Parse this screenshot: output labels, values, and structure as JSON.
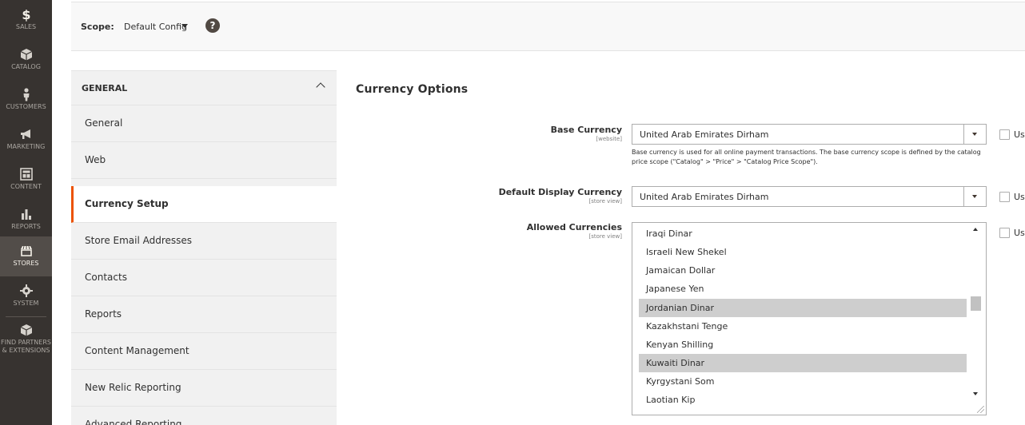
{
  "admin_nav": {
    "items": [
      {
        "label": "SALES",
        "icon": "dollar-icon"
      },
      {
        "label": "CATALOG",
        "icon": "box-icon"
      },
      {
        "label": "CUSTOMERS",
        "icon": "person-icon"
      },
      {
        "label": "MARKETING",
        "icon": "megaphone-icon"
      },
      {
        "label": "CONTENT",
        "icon": "layout-icon"
      },
      {
        "label": "REPORTS",
        "icon": "bar-chart-icon"
      },
      {
        "label": "STORES",
        "icon": "store-icon"
      },
      {
        "label": "SYSTEM",
        "icon": "gear-icon"
      },
      {
        "label_line1": "FIND PARTNERS",
        "label_line2": "& EXTENSIONS",
        "icon": "partners-icon"
      }
    ],
    "active": "STORES"
  },
  "scope": {
    "label": "Scope:",
    "value": "Default Config",
    "help": "?"
  },
  "config_nav": {
    "section_title": "GENERAL",
    "items": [
      "General",
      "Web",
      "Currency Setup",
      "Store Email Addresses",
      "Contacts",
      "Reports",
      "Content Management",
      "New Relic Reporting",
      "Advanced Reporting"
    ],
    "active": "Currency Setup"
  },
  "form": {
    "heading": "Currency Options",
    "base_currency": {
      "label": "Base Currency",
      "scope": "[website]",
      "value": "United Arab Emirates Dirham",
      "note": "Base currency is used for all online payment transactions. The base currency scope is defined by the catalog price scope (\"Catalog\" > \"Price\" > \"Catalog Price Scope\")."
    },
    "display_currency": {
      "label": "Default Display Currency",
      "scope": "[store view]",
      "value": "United Arab Emirates Dirham"
    },
    "allowed_currencies": {
      "label": "Allowed Currencies",
      "scope": "[store view]",
      "options": [
        {
          "label": "Iraqi Dinar",
          "selected": false
        },
        {
          "label": "Israeli New Shekel",
          "selected": false
        },
        {
          "label": "Jamaican Dollar",
          "selected": false
        },
        {
          "label": "Japanese Yen",
          "selected": false
        },
        {
          "label": "Jordanian Dinar",
          "selected": true
        },
        {
          "label": "Kazakhstani Tenge",
          "selected": false
        },
        {
          "label": "Kenyan Shilling",
          "selected": false
        },
        {
          "label": "Kuwaiti Dinar",
          "selected": true
        },
        {
          "label": "Kyrgystani Som",
          "selected": false
        },
        {
          "label": "Laotian Kip",
          "selected": false
        }
      ]
    },
    "use_default_label": "Use"
  },
  "colors": {
    "nav_bg": "#373330",
    "nav_active": "#524d49",
    "accent": "#eb5202",
    "selected_option": "#cecece"
  }
}
